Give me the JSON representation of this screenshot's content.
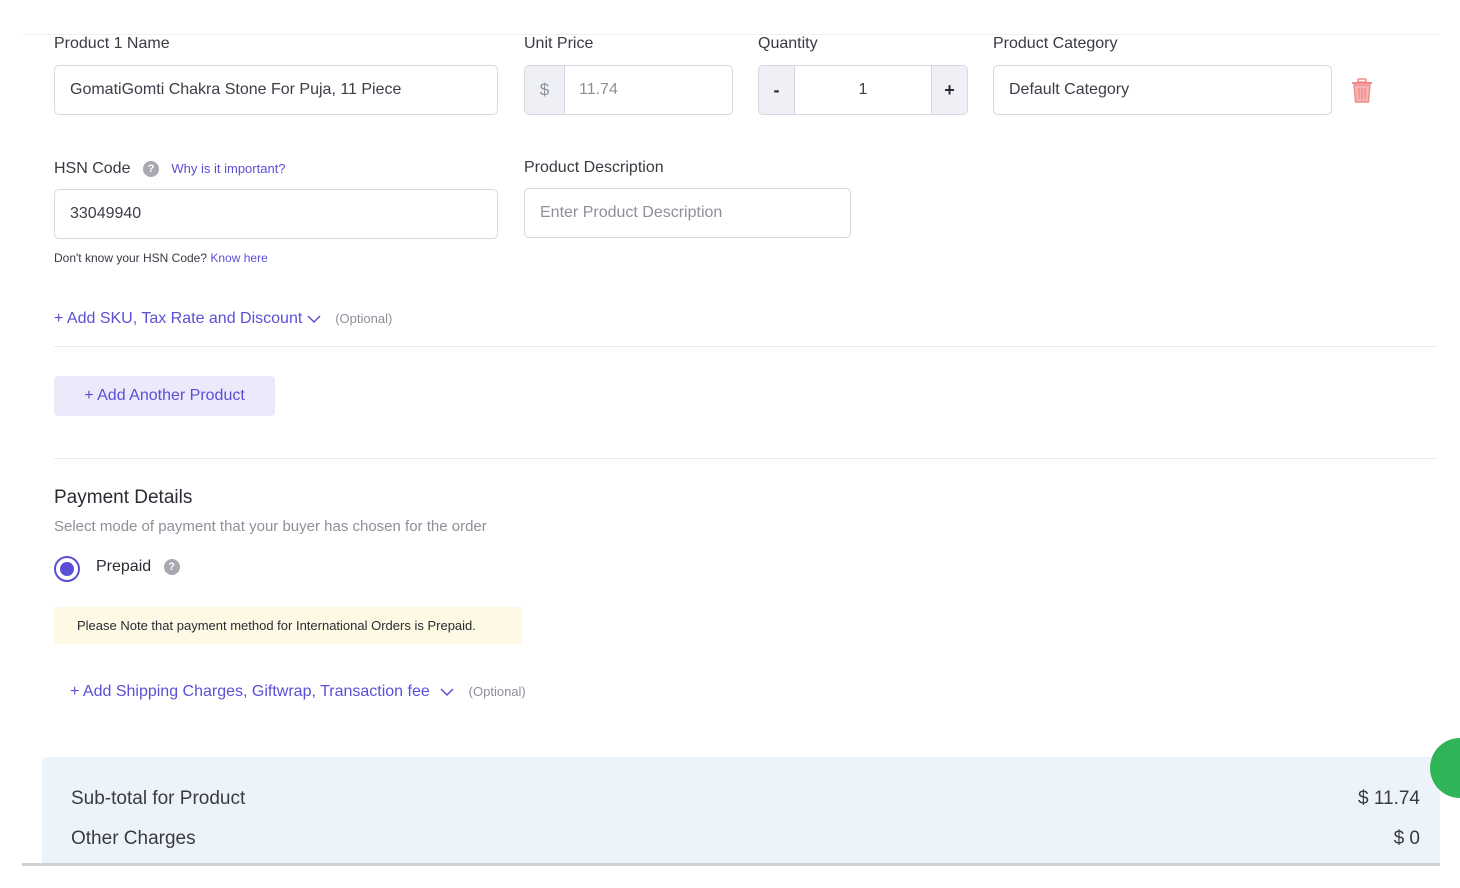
{
  "product": {
    "name_label": "Product 1 Name",
    "name_value": "GomatiGomti Chakra Stone For Puja, 11 Piece",
    "price_label": "Unit Price",
    "currency_symbol": "$",
    "price_value": "11.74",
    "qty_label": "Quantity",
    "qty_minus": "-",
    "qty_value": "1",
    "qty_plus": "+",
    "category_label": "Product Category",
    "category_value": "Default Category",
    "hsn_label": "HSN Code",
    "hsn_help": "?",
    "hsn_why": "Why is it important?",
    "hsn_value": "33049940",
    "hsn_hint": "Don't know your HSN Code?",
    "hsn_know": "Know here",
    "desc_label": "Product Description",
    "desc_placeholder": "Enter Product Description",
    "add_sku_label": "+ Add SKU, Tax Rate and Discount",
    "optional": "(Optional)"
  },
  "add_product_label": "+ Add Another Product",
  "payment": {
    "title": "Payment Details",
    "subtitle": "Select mode of payment that your buyer has chosen for the order",
    "option_label": "Prepaid",
    "help": "?",
    "note": "Please Note that payment method for International Orders is Prepaid.",
    "add_charges_label": "+ Add Shipping Charges, Giftwrap, Transaction fee",
    "optional": "(Optional)"
  },
  "totals": {
    "subtotal_label": "Sub-total for Product",
    "subtotal_value": "$ 11.74",
    "other_label": "Other Charges",
    "other_value": "$ 0"
  },
  "colors": {
    "accent": "#5b4fd6",
    "trash": "#f08a8a",
    "fab": "#2fb457"
  }
}
